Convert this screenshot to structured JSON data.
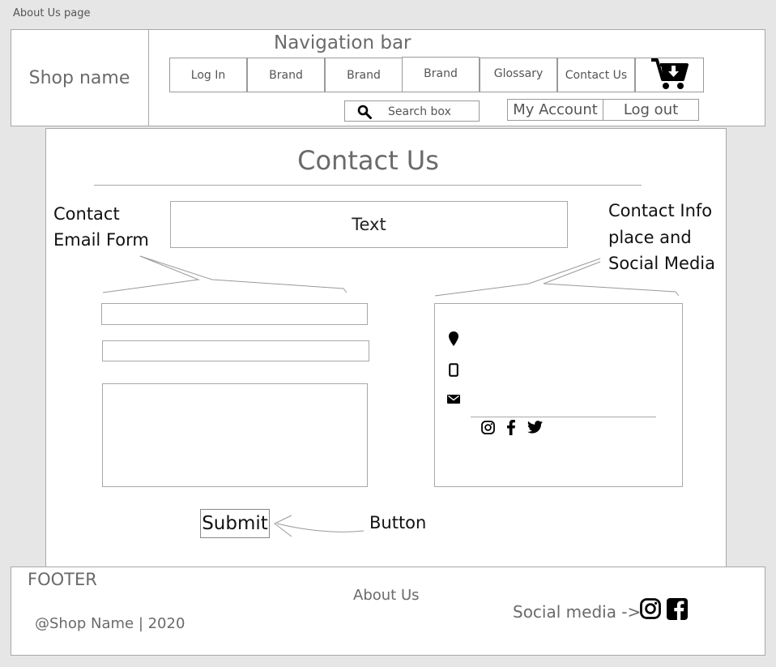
{
  "page_label": "About Us page",
  "header": {
    "shop_name": "Shop name",
    "nav_caption": "Navigation bar",
    "nav_items": [
      "Log In",
      "Brand",
      "Brand",
      "Brand",
      "Glossary",
      "Contact Us"
    ],
    "cart_icon": "cart-download-icon",
    "search_placeholder": "Search box",
    "my_account": "My Account",
    "log_out": "Log out"
  },
  "main": {
    "title": "Contact Us",
    "text_box": "Text",
    "annotations": {
      "form_line1": "Contact",
      "form_line2": "Email Form",
      "info_line1": "Contact Info",
      "info_line2": "place and",
      "info_line3": "Social Media",
      "button_note": "Button"
    },
    "submit_label": "Submit",
    "contact_icons": [
      "location-pin-icon",
      "phone-icon",
      "email-icon"
    ],
    "social_icons": [
      "instagram-icon",
      "facebook-icon",
      "twitter-icon"
    ]
  },
  "footer": {
    "label": "FOOTER",
    "copyright": "@Shop Name | 2020",
    "about_link": "About Us",
    "social_text": "Social media ->",
    "social_icons": [
      "instagram-icon",
      "facebook-square-icon"
    ]
  }
}
